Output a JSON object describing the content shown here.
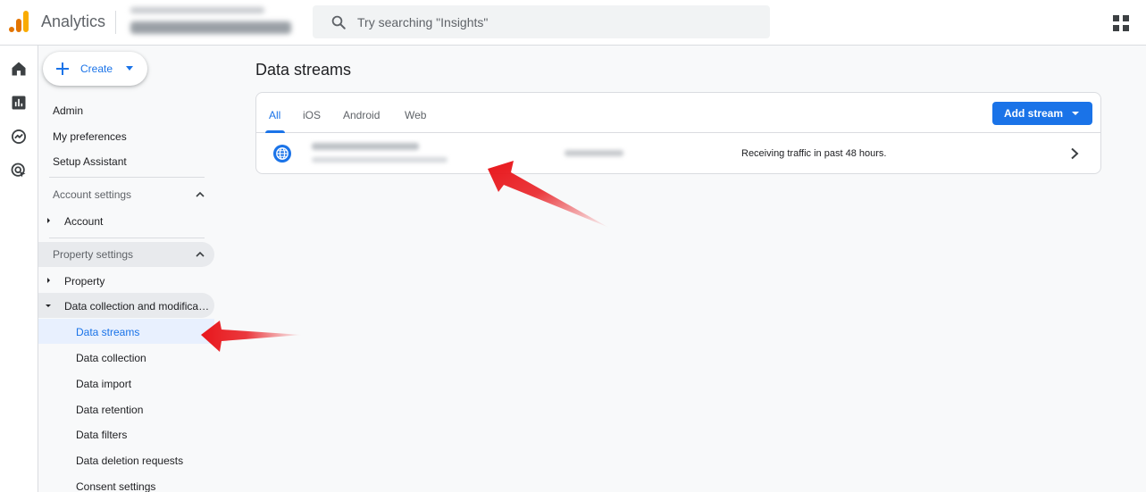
{
  "header": {
    "app_title": "Analytics",
    "search_placeholder": "Try searching \"Insights\""
  },
  "nav": {
    "create_label": "Create",
    "top_items": [
      "Admin",
      "My preferences",
      "Setup Assistant"
    ],
    "account_settings": {
      "label": "Account settings",
      "items": [
        "Account"
      ]
    },
    "property_settings": {
      "label": "Property settings",
      "property": "Property",
      "data_collection": "Data collection and modifica…",
      "sub_items": [
        "Data streams",
        "Data collection",
        "Data import",
        "Data retention",
        "Data filters",
        "Data deletion requests",
        "Consent settings"
      ]
    }
  },
  "main": {
    "page_title": "Data streams",
    "tabs": [
      "All",
      "iOS",
      "Android",
      "Web"
    ],
    "add_stream_label": "Add stream",
    "stream": {
      "status": "Receiving traffic in past 48 hours."
    }
  },
  "colors": {
    "accent": "#1a73e8",
    "logo_orange": "#f9ab00",
    "logo_dark_orange": "#e37400",
    "annotation_red": "#e8171c"
  },
  "icons": {
    "rail": [
      "home-icon",
      "reports-icon",
      "explore-icon",
      "advertising-icon"
    ],
    "header": [
      "search-icon",
      "apps-icon"
    ],
    "stream": [
      "globe-icon",
      "chevron-right-icon"
    ]
  }
}
